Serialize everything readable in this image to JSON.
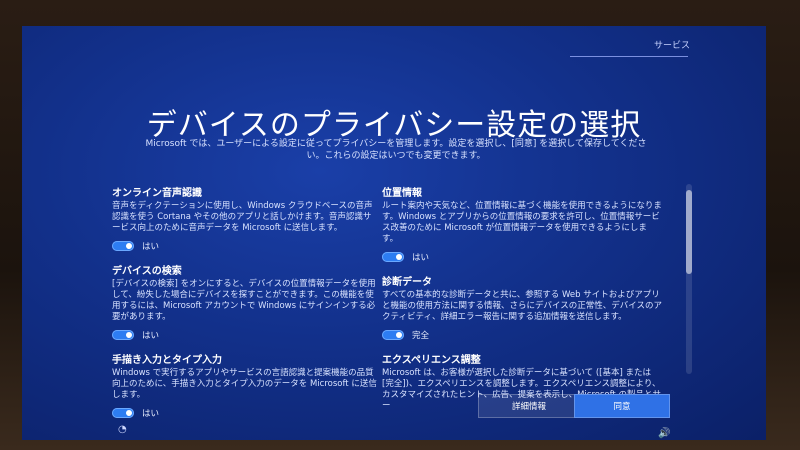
{
  "header": {
    "tab_label": "サービス",
    "title": "デバイスのプライバシー設定の選択",
    "intro": "Microsoft では、ユーザーによる設定に従ってプライバシーを管理します。設定を選択し、[同意] を選択して保存してください。これらの設定はいつでも変更できます。"
  },
  "left": {
    "speech": {
      "title": "オンライン音声認識",
      "desc": "音声をディクテーションに使用し、Windows クラウドベースの音声認識を使う Cortana やその他のアプリと話しかけます。音声認識サービス向上のために音声データを Microsoft に送信します。",
      "toggle_label": "はい"
    },
    "find_device": {
      "title": "デバイスの検索",
      "desc": "[デバイスの検索] をオンにすると、デバイスの位置情報データを使用して、紛失した場合にデバイスを探すことができます。この機能を使用するには、Microsoft アカウントで Windows にサインインする必要があります。",
      "toggle_label": "はい"
    },
    "inking": {
      "title": "手描き入力とタイプ入力",
      "desc": "Windows で実行するアプリやサービスの言語認識と提案機能の品質向上のために、手描き入力とタイプ入力のデータを Microsoft に送信します。",
      "toggle_label": "はい"
    }
  },
  "right": {
    "location": {
      "title": "位置情報",
      "desc": "ルート案内や天気など、位置情報に基づく機能を使用できるようになります。Windows とアプリからの位置情報の要求を許可し、位置情報サービス改善のために Microsoft が位置情報データを使用できるようにします。",
      "toggle_label": "はい"
    },
    "diagnostics": {
      "title": "診断データ",
      "desc": "すべての基本的な診断データと共に、参照する Web サイトおよびアプリと機能の使用方法に関する情報、さらにデバイスの正常性、デバイスのアクティビティ、詳細エラー報告に関する追加情報を送信します。",
      "toggle_label": "完全"
    },
    "tailored": {
      "title": "エクスペリエンス調整",
      "desc": "Microsoft は、お客様が選択した診断データに基づいて ([基本] または [完全])、エクスペリエンスを調整します。エクスペリエンス調整により、カスタマイズされたヒント、広告、提案を表示し、Microsoft の製品とサー"
    }
  },
  "buttons": {
    "details": "詳細情報",
    "accept": "同意"
  },
  "icons": {
    "accessibility_glyph": "◔",
    "volume_glyph": "🔊"
  },
  "colors": {
    "accent": "#2f71e6",
    "toggle_on": "#2d7df2"
  }
}
